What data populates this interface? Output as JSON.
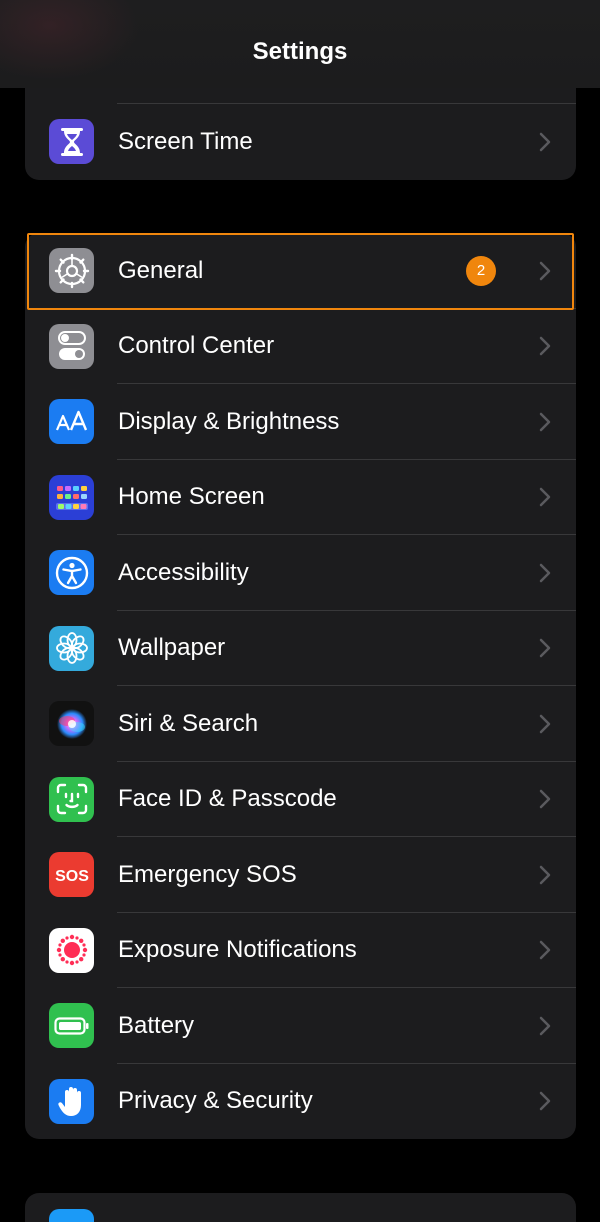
{
  "nav": {
    "title": "Settings"
  },
  "top_group": {
    "items": [
      {
        "label": "Screen Time",
        "icon": "hourglass-icon",
        "color": "#5b4bd6"
      }
    ]
  },
  "main_group": {
    "items": [
      {
        "label": "General",
        "icon": "gear-icon",
        "color": "#8e8e93",
        "badge": "2"
      },
      {
        "label": "Control Center",
        "icon": "toggles-icon",
        "color": "#8e8e93"
      },
      {
        "label": "Display & Brightness",
        "icon": "text-size-icon",
        "color": "#1b7cf2"
      },
      {
        "label": "Home Screen",
        "icon": "app-grid-icon",
        "color": "#2b3fd6"
      },
      {
        "label": "Accessibility",
        "icon": "accessibility-icon",
        "color": "#1b7cf2"
      },
      {
        "label": "Wallpaper",
        "icon": "flower-icon",
        "color": "#34aadc"
      },
      {
        "label": "Siri & Search",
        "icon": "siri-icon",
        "color": "#1a1a1a"
      },
      {
        "label": "Face ID & Passcode",
        "icon": "face-id-icon",
        "color": "#30c04f"
      },
      {
        "label": "Emergency SOS",
        "icon": "sos-icon",
        "color": "#eb3b30"
      },
      {
        "label": "Exposure Notifications",
        "icon": "exposure-icon",
        "color": "#ffffff"
      },
      {
        "label": "Battery",
        "icon": "battery-icon",
        "color": "#30c04f"
      },
      {
        "label": "Privacy & Security",
        "icon": "hand-icon",
        "color": "#1b7cf2"
      }
    ]
  },
  "bottom_group": {
    "items": [
      {
        "label": "",
        "icon": "app-store-icon",
        "color": "#1b9af7"
      }
    ]
  },
  "colors": {
    "background": "#000000",
    "group": "#1c1c1e",
    "separator": "#38383a",
    "chevron": "#5a5a5e",
    "badge": "#f0860d",
    "highlight": "#f0860d"
  }
}
